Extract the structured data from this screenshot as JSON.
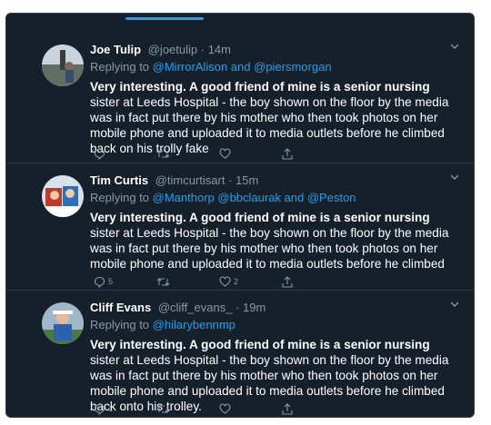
{
  "tweets": [
    {
      "name": "Joe Tulip",
      "handle": "@joetulip",
      "separator": " · ",
      "time": "14m",
      "replying_prefix": "Replying to ",
      "mentions": "@MirrorAlison and @piersmorgan",
      "body_bold": "Very interesting. A good friend of mine is a senior nursing",
      "body_rest": " sister at Leeds Hospital - the boy shown on the floor by the media was in fact put there by his mother who then took photos on her mobile phone and uploaded it to media outlets before he climbed back on his trolly fake",
      "reply_count": "",
      "retweet_count": "",
      "like_count": "",
      "avatar_color": "#6b7a6e",
      "icons": [
        "reply-icon",
        "retweet-icon",
        "like-icon",
        "share-icon"
      ]
    },
    {
      "name": "Tim Curtis",
      "handle": "@timcurtisart",
      "separator": " · ",
      "time": "15m",
      "replying_prefix": "Replying to ",
      "mentions": "@Manthorp @bbclaurak and @Peston",
      "body_bold": "Very interesting. A good friend of mine is a senior nursing",
      "body_rest": " sister at Leeds Hospital - the boy shown on the floor by the media was in fact put there by his mother who then took photos on her mobile phone and uploaded it to media outlets before he climbed",
      "reply_count": "5",
      "retweet_count": "",
      "like_count": "2",
      "avatar_color": "#b03a3a",
      "icons": [
        "reply-icon",
        "retweet-icon",
        "like-icon",
        "share-icon"
      ]
    },
    {
      "name": "Cliff Evans",
      "handle": "@cliff_evans_",
      "separator": " · ",
      "time": "19m",
      "replying_prefix": "Replying to ",
      "mentions": "@hilarybennmp",
      "body_bold": "Very interesting. A good friend of mine is a senior nursing",
      "body_rest": " sister at Leeds Hospital - the boy shown on the floor by the media was in fact put there by his mother who then took photos on her mobile phone and uploaded it to media outlets before he climbed back onto his trolley.",
      "reply_count": "1",
      "retweet_count": "",
      "like_count": "",
      "avatar_color": "#3b6fb0",
      "icons": [
        "reply-icon",
        "retweet-icon",
        "like-icon",
        "share-icon"
      ]
    }
  ],
  "colors": {
    "background": "#15202b",
    "accent": "#1da1f2",
    "muted": "#8899a6",
    "text": "#ffffff",
    "border": "#2f3b47"
  }
}
